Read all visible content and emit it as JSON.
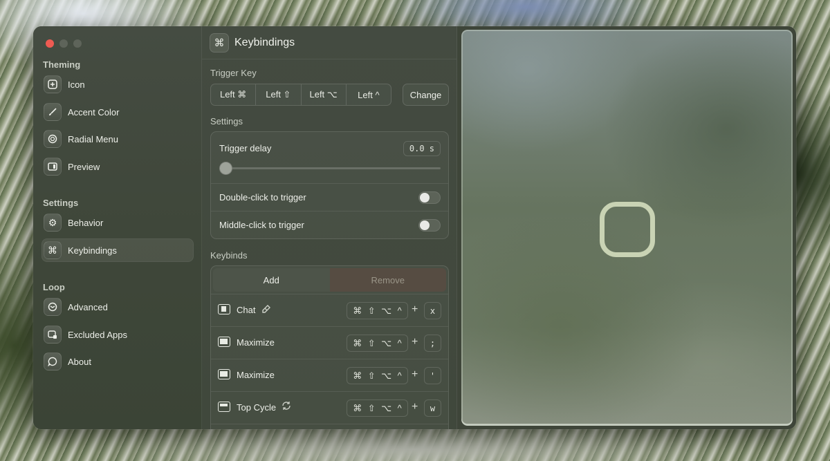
{
  "sidebar": {
    "sections": [
      "Theming",
      "Settings",
      "Loop"
    ],
    "items": [
      {
        "label": "Icon",
        "icon": "app-icon"
      },
      {
        "label": "Accent Color",
        "icon": "paintbrush-icon"
      },
      {
        "label": "Radial Menu",
        "icon": "radial-menu-icon"
      },
      {
        "label": "Preview",
        "icon": "preview-icon"
      },
      {
        "label": "Behavior",
        "icon": "gear-icon"
      },
      {
        "label": "Keybindings",
        "icon": "command-icon",
        "active": true
      },
      {
        "label": "Advanced",
        "icon": "advanced-icon"
      },
      {
        "label": "Excluded Apps",
        "icon": "excluded-apps-icon"
      },
      {
        "label": "About",
        "icon": "about-icon"
      }
    ]
  },
  "header": {
    "title": "Keybindings",
    "icon": "command-icon"
  },
  "trigger_key": {
    "label": "Trigger Key",
    "keys": [
      "Left ⌘",
      "Left ⇧",
      "Left ⌥",
      "Left ^"
    ],
    "change_label": "Change"
  },
  "settings": {
    "label": "Settings",
    "trigger_delay_label": "Trigger delay",
    "trigger_delay_value": "0.0 s",
    "trigger_delay_fraction": 0.0,
    "double_click_label": "Double-click to trigger",
    "double_click_enabled": false,
    "middle_click_label": "Middle-click to trigger",
    "middle_click_enabled": false
  },
  "keybinds": {
    "label": "Keybinds",
    "add_label": "Add",
    "remove_label": "Remove",
    "rows": [
      {
        "name": "Chat",
        "extra_icon": "eraser-icon",
        "mods": [
          "⌘",
          "⇧",
          "⌥",
          "^"
        ],
        "plus": "+",
        "key": "x"
      },
      {
        "name": "Maximize",
        "mods": [
          "⌘",
          "⇧",
          "⌥",
          "^"
        ],
        "plus": "+",
        "key": ";"
      },
      {
        "name": "Maximize",
        "mods": [
          "⌘",
          "⇧",
          "⌥",
          "^"
        ],
        "plus": "+",
        "key": "'"
      },
      {
        "name": "Top Cycle",
        "extra_icon": "cycle-icon",
        "mods": [
          "⌘",
          "⇧",
          "⌥",
          "^"
        ],
        "plus": "+",
        "key": "w"
      }
    ]
  },
  "preview": {
    "icon": "loop-icon",
    "accent_color": "#c9d3b4"
  }
}
